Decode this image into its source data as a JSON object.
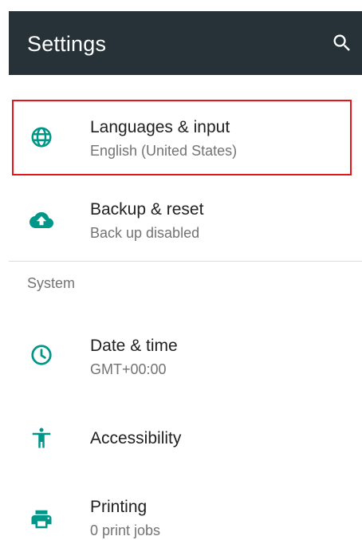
{
  "appbar": {
    "title": "Settings",
    "search_icon": "search-icon"
  },
  "colors": {
    "appbar": "#263238",
    "accent": "#009688",
    "highlight": "#e5141b"
  },
  "items": [
    {
      "label": "Languages & input",
      "subtitle": "English (United States)",
      "icon": "globe-icon"
    },
    {
      "label": "Backup & reset",
      "subtitle": "Back up disabled",
      "icon": "cloud-upload-icon"
    },
    {
      "label": "Date & time",
      "subtitle": "GMT+00:00",
      "icon": "clock-icon"
    },
    {
      "label": "Accessibility",
      "subtitle": "",
      "icon": "accessibility-icon"
    },
    {
      "label": "Printing",
      "subtitle": "0 print jobs",
      "icon": "printer-icon"
    }
  ],
  "section": {
    "system": "System"
  }
}
